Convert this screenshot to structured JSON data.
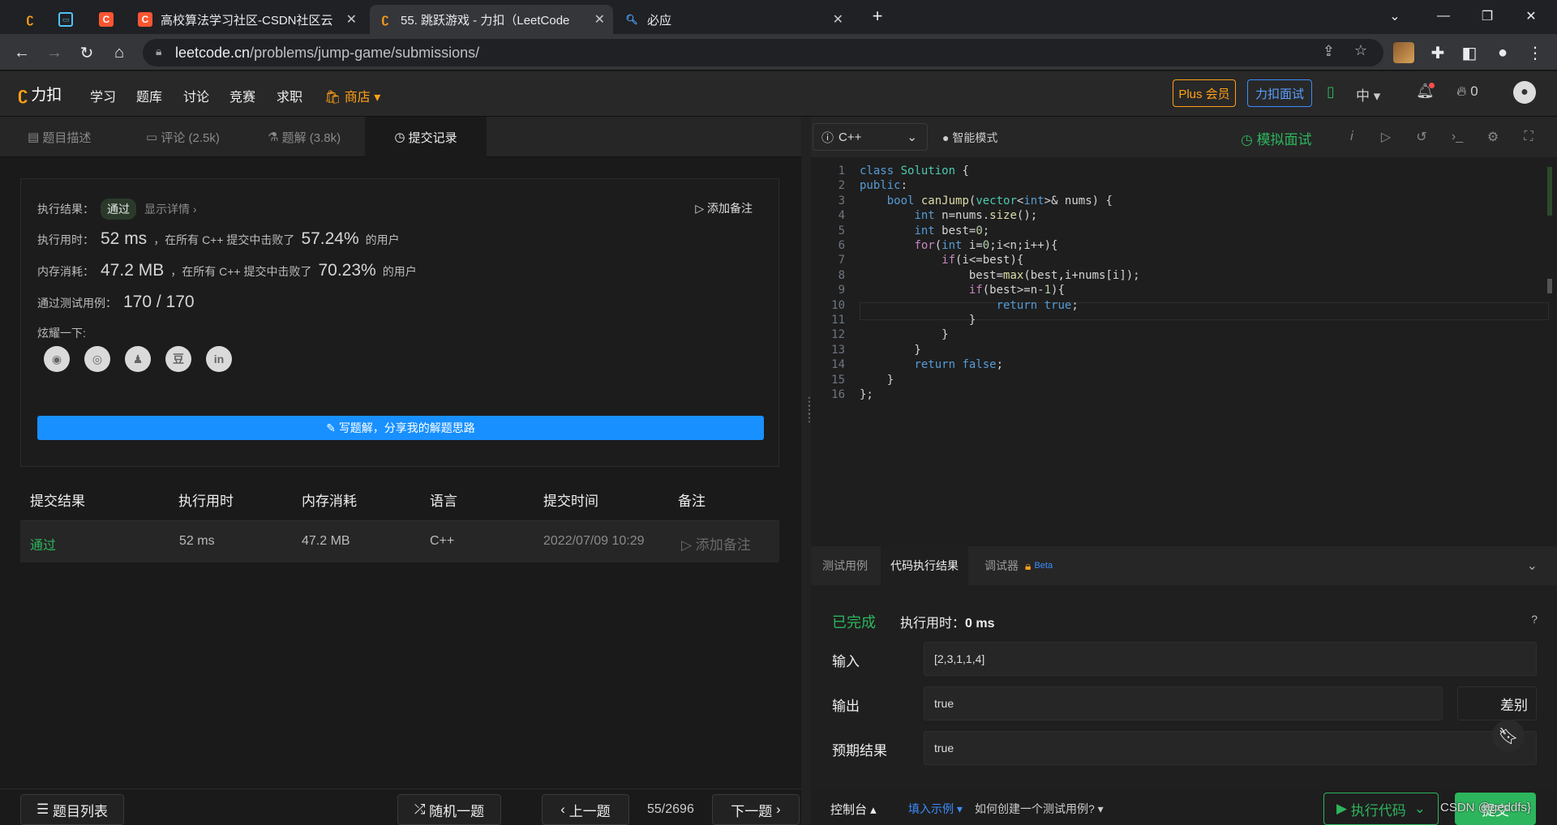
{
  "browser": {
    "tabs": [
      {
        "title": "",
        "icon": "lc-icon"
      },
      {
        "title": "",
        "icon": "bilibili-icon"
      },
      {
        "title": "",
        "icon": "csdn-icon"
      },
      {
        "title": "高校算法学习社区-CSDN社区云",
        "icon": "csdn-icon"
      },
      {
        "title": "55. 跳跃游戏 - 力扣（LeetCode",
        "icon": "lc-icon"
      },
      {
        "title": "必应",
        "icon": "search-icon"
      }
    ],
    "new_tab": "+",
    "url_host": "leetcode.cn",
    "url_path": "/problems/jump-game/submissions/"
  },
  "header": {
    "logo": "力扣",
    "nav": [
      "学习",
      "题库",
      "讨论",
      "竞赛",
      "求职"
    ],
    "shop": "商店",
    "plus": "Plus 会员",
    "interview": "力扣面试",
    "lang": "中",
    "coins": "0"
  },
  "left_tabs": [
    "题目描述",
    "评论 (2.5k)",
    "题解 (3.8k)",
    "提交记录"
  ],
  "result": {
    "label": "执行结果：",
    "status": "通过",
    "details": "显示详情 ›",
    "add_note": "添加备注",
    "time_label": "执行用时：",
    "time_value": "52 ms",
    "time_mid": "，在所有 C++ 提交中击败了",
    "time_pct": "57.24%",
    "time_suffix": "的用户",
    "mem_label": "内存消耗：",
    "mem_value": "47.2 MB",
    "mem_mid": "，在所有 C++ 提交中击败了",
    "mem_pct": "70.23%",
    "mem_suffix": "的用户",
    "tests_label": "通过测试用例：",
    "tests_value": "170 / 170",
    "share_label": "炫耀一下:",
    "write_button": "写题解，分享我的解题思路"
  },
  "submissions": {
    "headers": [
      "提交结果",
      "执行用时",
      "内存消耗",
      "语言",
      "提交时间",
      "备注"
    ],
    "rows": [
      {
        "status": "通过",
        "time": "52 ms",
        "memory": "47.2 MB",
        "language": "C++",
        "submitted": "2022/07/09 10:29",
        "note": "添加备注"
      }
    ]
  },
  "bottom_nav": {
    "list": "题目列表",
    "random": "随机一题",
    "prev": "上一题",
    "counter": "55/2696",
    "next": "下一题"
  },
  "editor": {
    "language": "C++",
    "mode": "智能模式",
    "mock_interview": "模拟面试",
    "line_numbers": [
      "1",
      "2",
      "3",
      "4",
      "5",
      "6",
      "7",
      "8",
      "9",
      "10",
      "11",
      "12",
      "13",
      "14",
      "15",
      "16"
    ],
    "code_lines": [
      "class Solution {",
      "public:",
      "    bool canJump(vector<int>& nums) {",
      "        int n=nums.size();",
      "        int best=0;",
      "        for(int i=0;i<n;i++){",
      "            if(i<=best){",
      "                best=max(best,i+nums[i]);",
      "                if(best>=n-1){",
      "                    return true;",
      "                }",
      "            }",
      "        }",
      "        return false;",
      "    }",
      "};"
    ]
  },
  "console": {
    "tabs": [
      "测试用例",
      "代码执行结果",
      "调试器"
    ],
    "beta": "Beta",
    "status": "已完成",
    "runtime_label": "执行用时：",
    "runtime_value": "0 ms",
    "input_label": "输入",
    "input_value": "[2,3,1,1,4]",
    "output_label": "输出",
    "output_value": "true",
    "diff": "差别",
    "expected_label": "预期结果",
    "expected_value": "true"
  },
  "editor_bottom": {
    "console": "控制台",
    "fill_example": "填入示例",
    "how_to": "如何创建一个测试用例?",
    "run": "执行代码",
    "submit": "提交"
  },
  "watermark": "CSDN @geddfs}",
  "colors": {
    "pass": "#2db55d",
    "primary": "#1890ff",
    "plus": "#ffa116"
  }
}
